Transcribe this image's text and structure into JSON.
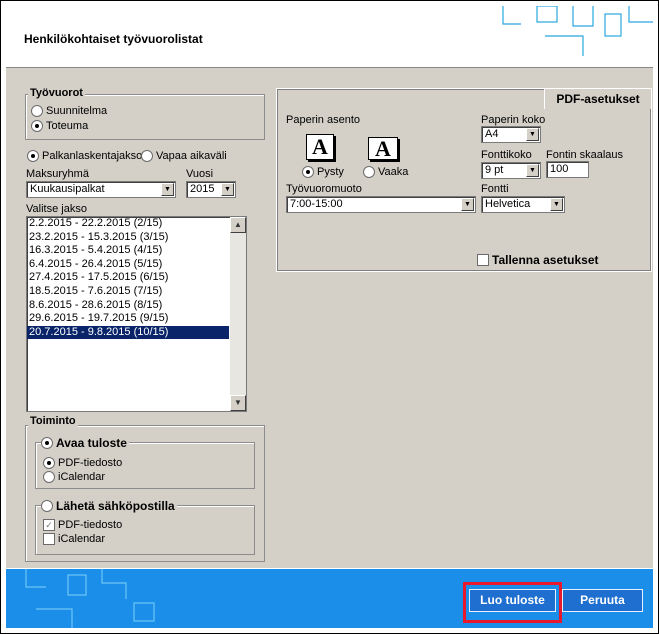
{
  "header": {
    "title": "Henkilökohtaiset työvuorolistat"
  },
  "tyovuorot": {
    "legend": "Työvuorot",
    "options": [
      "Suunnitelma",
      "Toteuma"
    ],
    "selected": "Toteuma"
  },
  "period_type": {
    "options": [
      "Palkanlaskentajakso",
      "Vapaa aikaväli"
    ],
    "selected": "Palkanlaskentajakso"
  },
  "maksuryhma": {
    "label": "Maksuryhmä",
    "value": "Kuukausipalkat"
  },
  "vuosi": {
    "label": "Vuosi",
    "value": "2015"
  },
  "jakso": {
    "label": "Valitse jakso",
    "items": [
      "2.2.2015 - 22.2.2015 (2/15)",
      "23.2.2015 - 15.3.2015 (3/15)",
      "16.3.2015 - 5.4.2015 (4/15)",
      "6.4.2015 - 26.4.2015 (5/15)",
      "27.4.2015 - 17.5.2015 (6/15)",
      "18.5.2015 - 7.6.2015 (7/15)",
      "8.6.2015 - 28.6.2015 (8/15)",
      "29.6.2015 - 19.7.2015 (9/15)",
      "20.7.2015 - 9.8.2015 (10/15)"
    ],
    "selected": "20.7.2015 - 9.8.2015 (10/15)"
  },
  "toiminto": {
    "legend": "Toiminto",
    "avaa": {
      "label": "Avaa tuloste",
      "selected": true,
      "pdf": "PDF-tiedosto",
      "ical": "iCalendar",
      "format_selected": "PDF-tiedosto"
    },
    "laheta": {
      "label": "Lähetä sähköpostilla",
      "selected": false,
      "pdf": "PDF-tiedosto",
      "ical": "iCalendar",
      "pdf_checked": true,
      "ical_checked": false
    }
  },
  "pdf": {
    "tab": "PDF-asetukset",
    "paperin_asento": "Paperin asento",
    "pysty": "Pysty",
    "vaaka": "Vaaka",
    "orientation_selected": "Pysty",
    "glyph": "A",
    "paperin_koko": {
      "label": "Paperin koko",
      "value": "A4"
    },
    "fonttikoko": {
      "label": "Fonttikoko",
      "value": "9 pt"
    },
    "fontin_skaalaus": {
      "label": "Fontin skaalaus",
      "value": "100"
    },
    "tyovuoromuoto": {
      "label": "Työvuoromuoto",
      "value": "7:00-15:00"
    },
    "fontti": {
      "label": "Fontti",
      "value": "Helvetica"
    },
    "tallenna": {
      "label": "Tallenna asetukset",
      "checked": false
    }
  },
  "buttons": {
    "create": "Luo tuloste",
    "cancel": "Peruuta"
  },
  "colors": {
    "footer": "#1a8ee8",
    "highlight": "#e8192c",
    "selection": "#0a246a"
  }
}
